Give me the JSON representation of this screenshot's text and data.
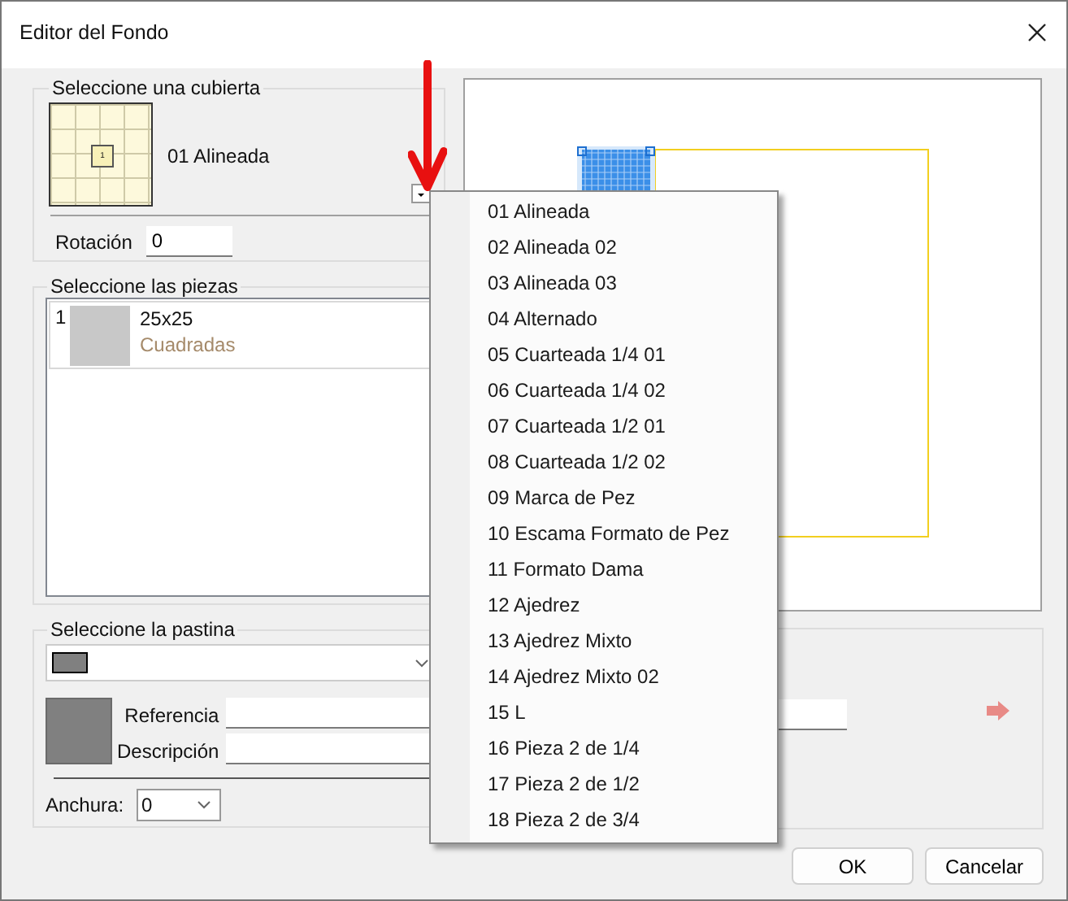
{
  "window": {
    "title": "Editor del Fondo"
  },
  "cover": {
    "legend": "Seleccione una cubierta",
    "thumbnail_label": "1",
    "name": "01 Alineada",
    "rotation_label": "Rotación",
    "rotation_value": "0"
  },
  "pieces": {
    "legend": "Seleccione las piezas",
    "items": [
      {
        "index": "1",
        "size": "25x25",
        "shape": "Cuadradas"
      }
    ]
  },
  "grout": {
    "legend": "Seleccione la pastina",
    "reference_label": "Referencia",
    "description_label": "Descripción",
    "width_label": "Anchura:",
    "width_value": "0"
  },
  "cover_menu": {
    "items": [
      "01 Alineada",
      "02 Alineada 02",
      "03 Alineada 03",
      "04 Alternado",
      "05 Cuarteada 1/4 01",
      "06 Cuarteada 1/4 02",
      "07 Cuarteada 1/2 01",
      "08 Cuarteada 1/2 02",
      "09 Marca de Pez",
      "10 Escama Formato de Pez",
      "11 Formato Dama",
      "12 Ajedrez",
      "13 Ajedrez Mixto",
      "14 Ajedrez Mixto 02",
      "15 L",
      "16 Pieza 2 de 1/4",
      "17 Pieza 2 de 1/2",
      "18 Pieza 2 de 3/4"
    ]
  },
  "buttons": [
    "OK",
    "Cancelar"
  ]
}
